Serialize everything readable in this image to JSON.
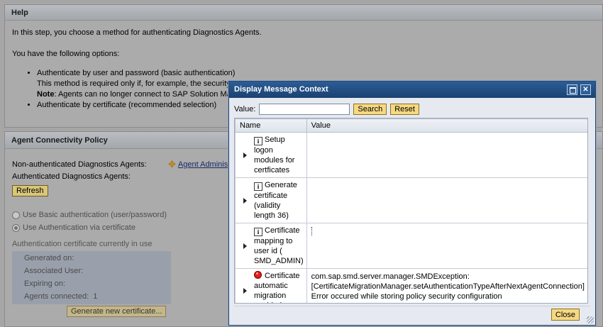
{
  "help": {
    "title": "Help",
    "intro": "In this step, you choose a method for authenticating Diagnostics Agents.",
    "options_intro": "You have the following options:",
    "opt1": "Authenticate by user and password (basic authentication)",
    "opt1_detail": "This method is required only if, for example, the security",
    "note_label": "Note",
    "note_text": ": Agents can no longer connect to SAP Solution Ma",
    "opt2": "Authenticate by certificate (recommended selection)"
  },
  "agent": {
    "title": "Agent Connectivity Policy",
    "non_auth_label": "Non-authenticated Diagnostics Agents:",
    "auth_label": "Authenticated Diagnostics Agents:",
    "admin_link": "Agent Adminis",
    "refresh": "Refresh",
    "radio_basic": "Use Basic authentication (user/password)",
    "radio_cert": "Use Authentication via certificate",
    "cert_heading": "Authentication certificate currently in use",
    "generated_on": "Generated on:",
    "associated_user": "Associated User:",
    "expiring_on": "Expiring on:",
    "agents_connected_label": "Agents connected:",
    "agents_connected_value": "1",
    "generate_btn": "Generate new certificate..."
  },
  "dialog": {
    "title": "Display Message Context",
    "value_label": "Value:",
    "value_input": "",
    "search": "Search",
    "reset": "Reset",
    "col_name": "Name",
    "col_value": "Value",
    "rows": [
      {
        "icon": "info-icon",
        "name": "Setup logon modules for certficates",
        "value": ""
      },
      {
        "icon": "info-icon",
        "name": "Generate certificate (validity length 36)",
        "value": ""
      },
      {
        "icon": "info-icon",
        "name": "Certificate mapping to user id ( SMD_ADMIN)",
        "value": ""
      },
      {
        "icon": "error-icon",
        "name": "Certificate automatic migration enabled",
        "value_l1": "com.sap.smd.server.manager.SMDException:",
        "value_l2": "[CertificateMigrationManager.setAuthenticationTypeAfterNextAgentConnection]",
        "value_l3": "Error occured while storing policy security configuration"
      }
    ],
    "close": "Close"
  }
}
